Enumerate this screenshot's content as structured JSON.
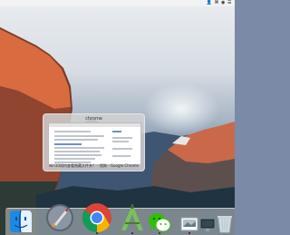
{
  "menubar": {
    "right_text": "👤  ⌘ ◉ ☰"
  },
  "switcher": {
    "app_name": "chrome",
    "caption": "win10如何查看隐藏文件夹？ - 搜狗 - Google Chrome"
  },
  "dock": {
    "items": [
      {
        "name": "finder-icon"
      },
      {
        "name": "launchpad-icon"
      },
      {
        "name": "chrome-icon"
      },
      {
        "name": "android-studio-icon"
      },
      {
        "name": "wechat-icon"
      },
      {
        "name": "preview-icon"
      },
      {
        "name": "display-icon"
      },
      {
        "name": "trash-icon"
      }
    ]
  },
  "colors": {
    "chrome_red": "#db4437",
    "chrome_green": "#0f9d58",
    "chrome_yellow": "#f4b400",
    "chrome_blue": "#4285f4",
    "android_green": "#78c257",
    "wechat_green": "#2dc100"
  }
}
